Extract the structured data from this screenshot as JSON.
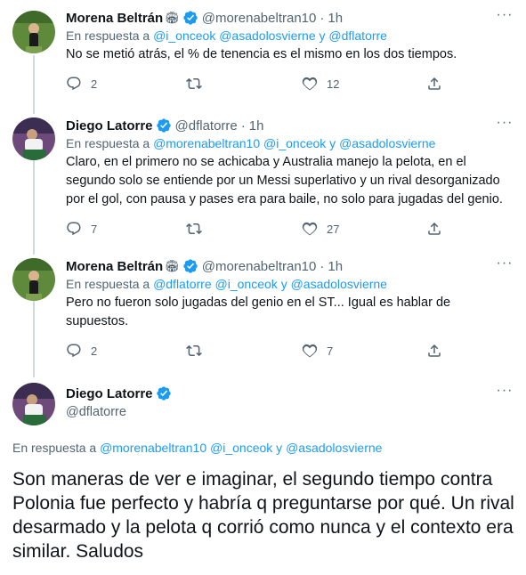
{
  "tweets": [
    {
      "name": "Morena Beltrán",
      "emoji": "🏟",
      "handle": "@morenabeltran10",
      "time": "1h",
      "reply_prefix": "En respuesta a",
      "mentions": [
        "@i_onceok",
        "@asadolosvierne",
        "@dflatorre"
      ],
      "conj": "y",
      "text": "No se metió atrás, el % de tenencia es el mismo en los dos tiempos.",
      "replies": "2",
      "retweets": "",
      "likes": "12"
    },
    {
      "name": "Diego Latorre",
      "handle": "@dflatorre",
      "time": "1h",
      "reply_prefix": "En respuesta a",
      "mentions": [
        "@morenabeltran10",
        "@i_onceok",
        "@asadolosvierne"
      ],
      "conj": "y",
      "text": "Claro, en el primero no se achicaba y Australia manejo la pelota, en el segundo solo se entiende por un Messi superlativo y un rival desorganizado por el gol, con pausa y pases era para baile, no solo para jugadas del genio.",
      "replies": "7",
      "retweets": "",
      "likes": "27"
    },
    {
      "name": "Morena Beltrán",
      "emoji": "🏟",
      "handle": "@morenabeltran10",
      "time": "1h",
      "reply_prefix": "En respuesta a",
      "mentions": [
        "@dflatorre",
        "@i_onceok",
        "@asadolosvierne"
      ],
      "conj": "y",
      "text": "Pero no fueron solo jugadas del genio en el ST... Igual es hablar de supuestos.",
      "replies": "2",
      "retweets": "",
      "likes": "7"
    }
  ],
  "main_tweet": {
    "name": "Diego Latorre",
    "handle": "@dflatorre",
    "reply_prefix": "En respuesta a",
    "mentions": [
      "@morenabeltran10",
      "@i_onceok",
      "@asadolosvierne"
    ],
    "conj": "y",
    "text": "Son maneras de ver e imaginar, el segundo tiempo contra Polonia fue perfecto y habría q preguntarse por qué. Un rival desarmado y la pelota q corrió como nunca y el contexto era similar. Saludos"
  },
  "icons": {
    "reply": "reply-icon",
    "retweet": "retweet-icon",
    "like": "heart-icon",
    "share": "share-icon",
    "more": "more-icon",
    "verified": "verified-badge-icon"
  },
  "colors": {
    "accent": "#1d9bf0",
    "muted": "#536471",
    "text": "#0f1419",
    "thread_line": "#cfd9de"
  }
}
